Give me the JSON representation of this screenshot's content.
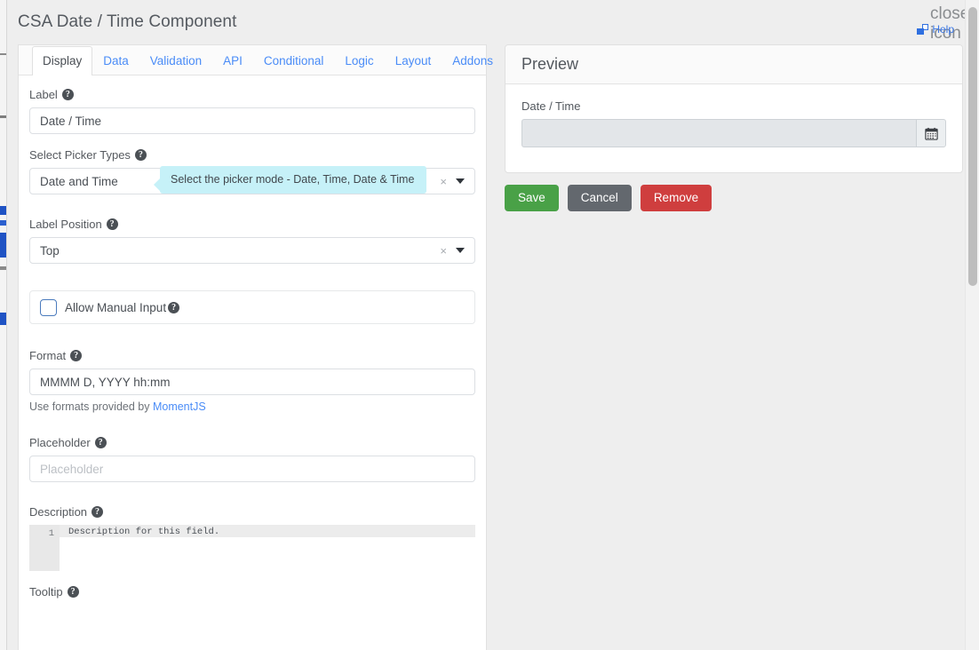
{
  "window": {
    "title": "CSA Date / Time Component",
    "close_icon": "close-icon",
    "help_label": "Help",
    "help_icon": "external-window-icon"
  },
  "tabs": [
    {
      "label": "Display",
      "active": true
    },
    {
      "label": "Data",
      "active": false
    },
    {
      "label": "Validation",
      "active": false
    },
    {
      "label": "API",
      "active": false
    },
    {
      "label": "Conditional",
      "active": false
    },
    {
      "label": "Logic",
      "active": false
    },
    {
      "label": "Layout",
      "active": false
    },
    {
      "label": "Addons",
      "active": false
    }
  ],
  "form": {
    "label_field": {
      "label": "Label",
      "value": "Date / Time",
      "help_icon": "question-mark-icon"
    },
    "picker_types": {
      "label": "Select Picker Types",
      "value": "Date and Time",
      "clear_icon": "×",
      "caret_icon": "chevron-down-icon",
      "tooltip": "Select the picker mode - Date, Time, Date & Time"
    },
    "label_position": {
      "label": "Label Position",
      "value": "Top",
      "clear_icon": "×",
      "caret_icon": "chevron-down-icon"
    },
    "allow_manual_input": {
      "label": "Allow Manual Input",
      "checked": false
    },
    "format": {
      "label": "Format",
      "value": "MMMM D, YYYY hh:mm",
      "help_prefix": "Use formats provided by ",
      "help_link": "MomentJS"
    },
    "placeholder": {
      "label": "Placeholder",
      "value": "",
      "placeholder": "Placeholder"
    },
    "description": {
      "label": "Description",
      "line_number": "1",
      "code": "Description for this field."
    },
    "tooltip_field": {
      "label": "Tooltip"
    }
  },
  "preview": {
    "title": "Preview",
    "field_label": "Date / Time",
    "field_value": "",
    "calendar_icon": "calendar-icon"
  },
  "actions": {
    "save": "Save",
    "cancel": "Cancel",
    "remove": "Remove"
  },
  "colors": {
    "save": "#49a147",
    "cancel": "#63686e",
    "remove": "#cf3e3e",
    "link": "#4a8cf7",
    "tooltip_bg": "#c6f1f8"
  }
}
